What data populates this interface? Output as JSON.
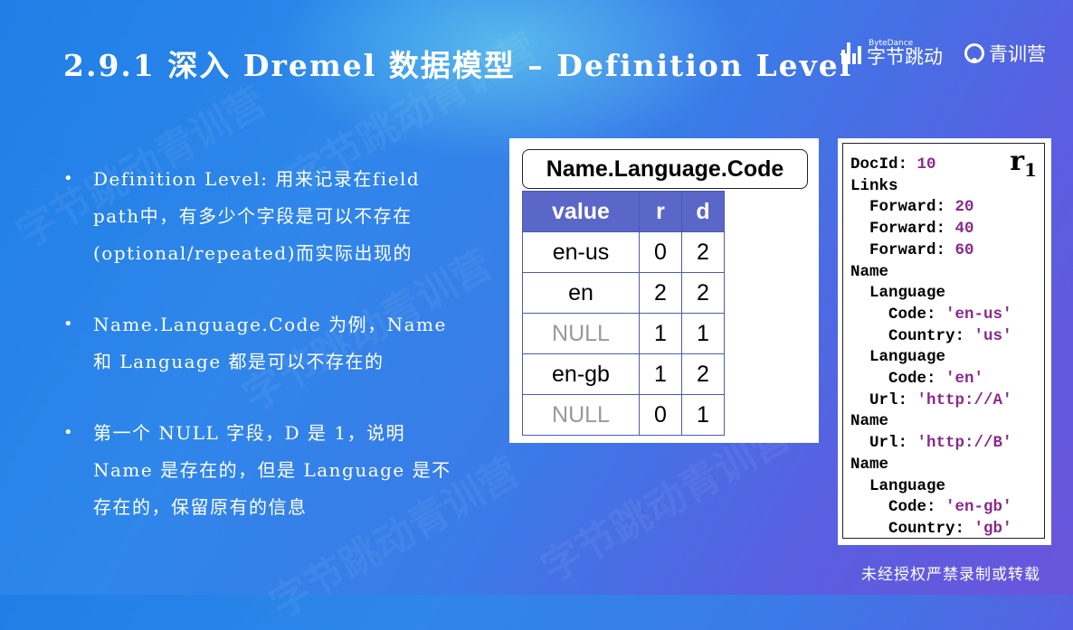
{
  "title": "2.9.1  深入 Dremel 数据模型 – Definition Level",
  "brand": {
    "bytedance_small": "ByteDance",
    "bytedance_name": "字节跳动",
    "camp_name": "青训营"
  },
  "bullets": [
    "Definition Level: 用来记录在field path中，有多少个字段是可以不存在 (optional/repeated)而实际出现的",
    "Name.Language.Code 为例，Name 和 Language 都是可以不存在的",
    "第一个 NULL 字段，D 是 1，说明 Name 是存在的，但是 Language 是不存在的，保留原有的信息"
  ],
  "table": {
    "title": "Name.Language.Code",
    "headers": [
      "value",
      "r",
      "d"
    ],
    "rows": [
      [
        "en-us",
        "0",
        "2"
      ],
      [
        "en",
        "2",
        "2"
      ],
      [
        "NULL",
        "1",
        "1"
      ],
      [
        "en-gb",
        "1",
        "2"
      ],
      [
        "NULL",
        "0",
        "1"
      ]
    ]
  },
  "record": {
    "label": "r",
    "label_sub": "1",
    "lines": [
      {
        "indent": 0,
        "key": "DocId:",
        "value": "10"
      },
      {
        "indent": 0,
        "key": "Links",
        "value": ""
      },
      {
        "indent": 1,
        "key": "Forward:",
        "value": "20"
      },
      {
        "indent": 1,
        "key": "Forward:",
        "value": "40"
      },
      {
        "indent": 1,
        "key": "Forward:",
        "value": "60"
      },
      {
        "indent": 0,
        "key": "Name",
        "value": ""
      },
      {
        "indent": 1,
        "key": "Language",
        "value": ""
      },
      {
        "indent": 2,
        "key": "Code:",
        "value": "'en-us'"
      },
      {
        "indent": 2,
        "key": "Country:",
        "value": "'us'"
      },
      {
        "indent": 1,
        "key": "Language",
        "value": ""
      },
      {
        "indent": 2,
        "key": "Code:",
        "value": "'en'"
      },
      {
        "indent": 1,
        "key": "Url:",
        "value": "'http://A'"
      },
      {
        "indent": 0,
        "key": "Name",
        "value": ""
      },
      {
        "indent": 1,
        "key": "Url:",
        "value": "'http://B'"
      },
      {
        "indent": 0,
        "key": "Name",
        "value": ""
      },
      {
        "indent": 1,
        "key": "Language",
        "value": ""
      },
      {
        "indent": 2,
        "key": "Code:",
        "value": "'en-gb'"
      },
      {
        "indent": 2,
        "key": "Country:",
        "value": "'gb'"
      }
    ]
  },
  "footer": "未经授权严禁录制或转载",
  "colors": {
    "table_header": "#5a66c8",
    "record_value": "#8a2a8a",
    "null_text": "#999999"
  }
}
